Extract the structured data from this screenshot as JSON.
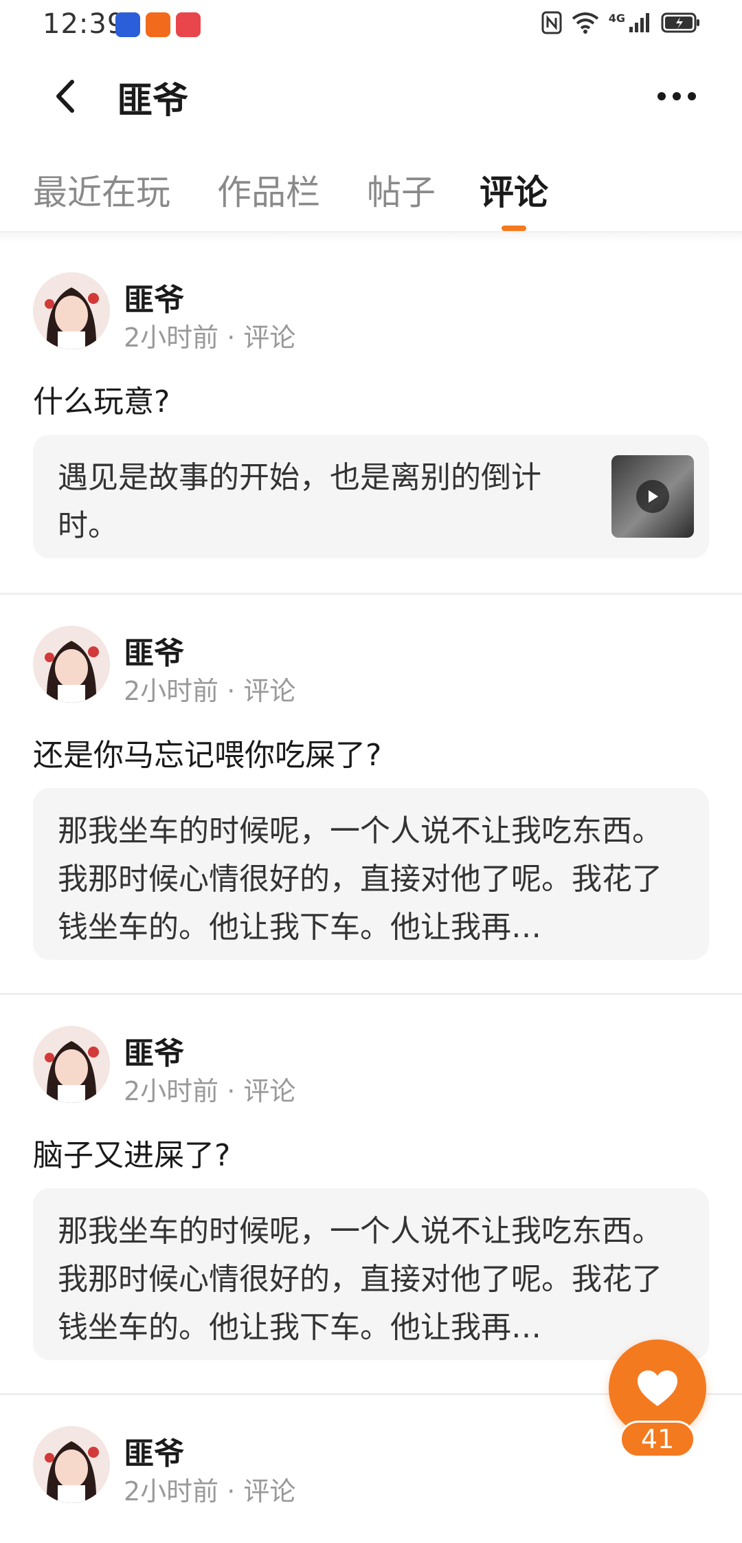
{
  "status_bar": {
    "time": "12:39",
    "app_icons": [
      "calendar-app-icon",
      "assistant-app-icon",
      "huawei-store-icon"
    ],
    "right_icons": [
      "nfc-icon",
      "wifi-icon",
      "signal-4g-icon",
      "battery-icon"
    ],
    "network_label": "4G"
  },
  "header": {
    "title": "匪爷",
    "back_icon": "chevron-left-icon",
    "more_icon": "more-dots-icon"
  },
  "tabs": [
    {
      "label": "最近在玩",
      "active": false
    },
    {
      "label": "作品栏",
      "active": false
    },
    {
      "label": "帖子",
      "active": false
    },
    {
      "label": "评论",
      "active": true
    }
  ],
  "accent_color": "#f47a20",
  "comments": [
    {
      "author": "匪爷",
      "meta": "2小时前 · 评论",
      "text": "什么玩意?",
      "quote": "遇见是故事的开始，也是离别的倒计时。",
      "has_video_thumb": true
    },
    {
      "author": "匪爷",
      "meta": "2小时前 · 评论",
      "text": "还是你马忘记喂你吃屎了?",
      "quote": "那我坐车的时候呢，一个人说不让我吃东西。我那时候心情很好的，直接对他了呢。我花了钱坐车的。他让我下车。他让我再…",
      "has_video_thumb": false
    },
    {
      "author": "匪爷",
      "meta": "2小时前 · 评论",
      "text": "脑子又进屎了?",
      "quote": "那我坐车的时候呢，一个人说不让我吃东西。我那时候心情很好的，直接对他了呢。我花了钱坐车的。他让我下车。他让我再…",
      "has_video_thumb": false
    },
    {
      "author": "匪爷",
      "meta": "2小时前 · 评论"
    }
  ],
  "like_button": {
    "icon": "heart-icon",
    "count": "41"
  }
}
